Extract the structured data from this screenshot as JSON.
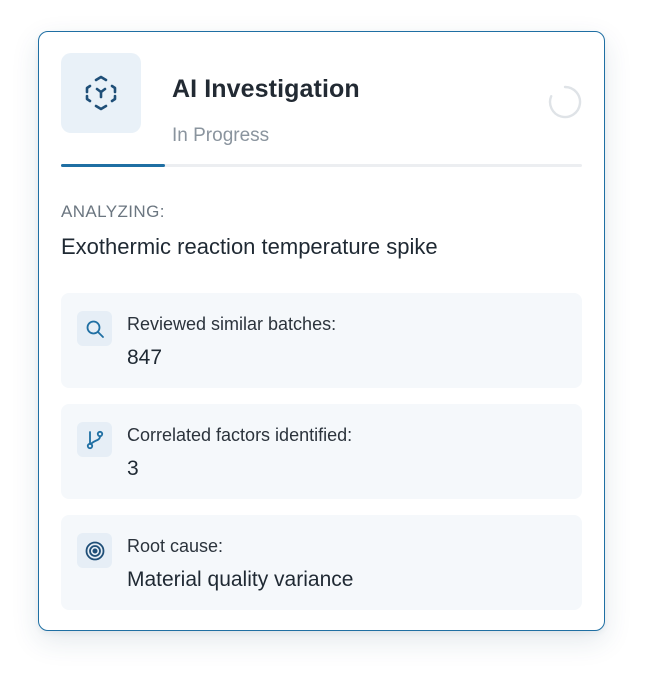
{
  "card": {
    "title": "AI Investigation",
    "status": "In Progress",
    "agent_icon": "ai-scan-icon",
    "spinner_icon": "loading-spinner-icon",
    "progress_fraction": 0.2
  },
  "analysis": {
    "label": "ANALYZING:",
    "subject": "Exothermic reaction temperature spike"
  },
  "steps": [
    {
      "icon": "search-icon",
      "label": "Reviewed similar batches:",
      "value": "847"
    },
    {
      "icon": "branch-icon",
      "label": "Correlated factors identified:",
      "value": "3"
    },
    {
      "icon": "target-icon",
      "label": "Root cause:",
      "value": "Material quality variance"
    }
  ],
  "colors": {
    "accent": "#1f6fa3",
    "icon_bg": "#e9f1f8",
    "step_bg": "#f5f8fb",
    "muted_text": "#8a949e"
  }
}
